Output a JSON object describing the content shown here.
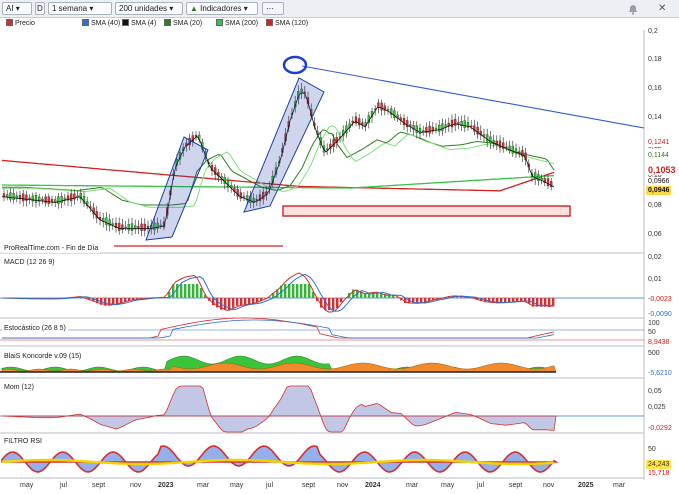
{
  "toolbar": {
    "symbol": "AI",
    "period_code": "D",
    "timeframe": "1 semana",
    "units": "200 unidades",
    "indicators": "Indicadores"
  },
  "legend": [
    {
      "label": "Precio",
      "color": "#c9302c"
    },
    {
      "label": "SMA (40)",
      "color": "#2f6fce"
    },
    {
      "label": "SMA (4)",
      "color": "#111111"
    },
    {
      "label": "SMA (20)",
      "color": "#2e7d1f"
    },
    {
      "label": "SMA (200)",
      "color": "#36c24a"
    },
    {
      "label": "SMA (120)",
      "color": "#d42020"
    }
  ],
  "price_panel": {
    "source_note": "ProRealTime.com - Fin de Día",
    "yticks": [
      "0,2",
      "0,18",
      "0,16",
      "0,14",
      "0,12",
      "0,10",
      "0,08",
      "0,06"
    ],
    "badges": [
      {
        "text": "0,1241",
        "color": "#d42020",
        "bg": "#ffffff"
      },
      {
        "text": "0,1144",
        "color": "#2e7d1f",
        "bg": "#ffffff"
      },
      {
        "text": "0,1053",
        "color": "#d42020",
        "bg": "#ffffff"
      },
      {
        "text": "0,0966",
        "color": "#111111",
        "bg": "#ffffff"
      },
      {
        "text": "0,0946",
        "color": "#111111",
        "bg": "#ffd84a"
      }
    ]
  },
  "macd": {
    "label": "MACD (12 26 9)",
    "yticks": [
      "0,02",
      "0,01"
    ],
    "badges": [
      "-0,0023",
      "-0,0090"
    ]
  },
  "stoch": {
    "label": "Estocástico (26 8 5)",
    "yticks": [
      "100",
      "50"
    ],
    "badges": [
      "8,9438"
    ]
  },
  "koncorde": {
    "label": "BlaiS Koncorde v.09 (15)",
    "yticks": [
      "500"
    ],
    "badges": [
      "-5,6210"
    ]
  },
  "mom": {
    "label": "Mom (12)",
    "yticks": [
      "0,05",
      "0,025"
    ],
    "badges": [
      "-0,0292"
    ]
  },
  "rsi": {
    "label": "FILTRO RSI",
    "yticks": [
      "50"
    ],
    "badges": [
      "24,243",
      "15,718"
    ]
  },
  "xaxis": [
    "may",
    "jul",
    "sept",
    "nov",
    "2023",
    "mar",
    "may",
    "jul",
    "sept",
    "nov",
    "2024",
    "mar",
    "may",
    "jul",
    "sept",
    "nov",
    "2025",
    "mar"
  ],
  "colors": {
    "trendline": "#2f5bd6",
    "support": "#d42020",
    "target_box": "#d42020",
    "highlight": "#1f3fa8"
  }
}
